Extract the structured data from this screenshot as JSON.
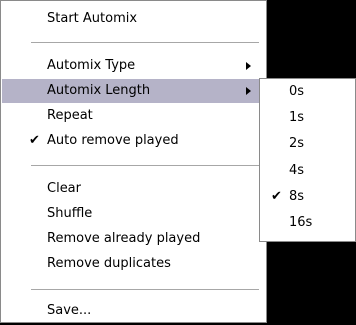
{
  "menu": {
    "items": [
      {
        "label": "Start Automix"
      },
      {
        "label": "Automix Type"
      },
      {
        "label": "Automix Length"
      },
      {
        "label": "Repeat"
      },
      {
        "label": "Auto remove played",
        "checked": true
      },
      {
        "label": "Clear"
      },
      {
        "label": "Shuffle"
      },
      {
        "label": "Remove already played"
      },
      {
        "label": "Remove duplicates"
      },
      {
        "label": "Save..."
      }
    ]
  },
  "submenu": {
    "items": [
      {
        "label": "0s"
      },
      {
        "label": "1s"
      },
      {
        "label": "2s"
      },
      {
        "label": "4s"
      },
      {
        "label": "8s",
        "checked": true
      },
      {
        "label": "16s"
      }
    ]
  },
  "glyphs": {
    "check": "✔"
  },
  "colors": {
    "highlight": "#b5b3c8",
    "background": "#000000"
  }
}
